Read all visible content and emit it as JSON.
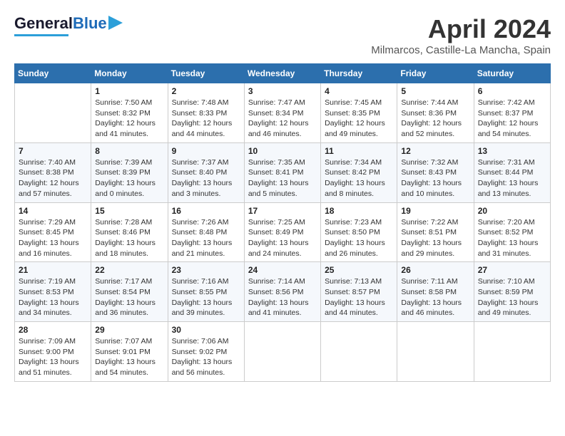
{
  "header": {
    "logo_general": "General",
    "logo_blue": "Blue",
    "month_title": "April 2024",
    "location": "Milmarcos, Castille-La Mancha, Spain"
  },
  "days_of_week": [
    "Sunday",
    "Monday",
    "Tuesday",
    "Wednesday",
    "Thursday",
    "Friday",
    "Saturday"
  ],
  "weeks": [
    [
      {
        "day": "",
        "sunrise": "",
        "sunset": "",
        "daylight": ""
      },
      {
        "day": "1",
        "sunrise": "Sunrise: 7:50 AM",
        "sunset": "Sunset: 8:32 PM",
        "daylight": "Daylight: 12 hours and 41 minutes."
      },
      {
        "day": "2",
        "sunrise": "Sunrise: 7:48 AM",
        "sunset": "Sunset: 8:33 PM",
        "daylight": "Daylight: 12 hours and 44 minutes."
      },
      {
        "day": "3",
        "sunrise": "Sunrise: 7:47 AM",
        "sunset": "Sunset: 8:34 PM",
        "daylight": "Daylight: 12 hours and 46 minutes."
      },
      {
        "day": "4",
        "sunrise": "Sunrise: 7:45 AM",
        "sunset": "Sunset: 8:35 PM",
        "daylight": "Daylight: 12 hours and 49 minutes."
      },
      {
        "day": "5",
        "sunrise": "Sunrise: 7:44 AM",
        "sunset": "Sunset: 8:36 PM",
        "daylight": "Daylight: 12 hours and 52 minutes."
      },
      {
        "day": "6",
        "sunrise": "Sunrise: 7:42 AM",
        "sunset": "Sunset: 8:37 PM",
        "daylight": "Daylight: 12 hours and 54 minutes."
      }
    ],
    [
      {
        "day": "7",
        "sunrise": "Sunrise: 7:40 AM",
        "sunset": "Sunset: 8:38 PM",
        "daylight": "Daylight: 12 hours and 57 minutes."
      },
      {
        "day": "8",
        "sunrise": "Sunrise: 7:39 AM",
        "sunset": "Sunset: 8:39 PM",
        "daylight": "Daylight: 13 hours and 0 minutes."
      },
      {
        "day": "9",
        "sunrise": "Sunrise: 7:37 AM",
        "sunset": "Sunset: 8:40 PM",
        "daylight": "Daylight: 13 hours and 3 minutes."
      },
      {
        "day": "10",
        "sunrise": "Sunrise: 7:35 AM",
        "sunset": "Sunset: 8:41 PM",
        "daylight": "Daylight: 13 hours and 5 minutes."
      },
      {
        "day": "11",
        "sunrise": "Sunrise: 7:34 AM",
        "sunset": "Sunset: 8:42 PM",
        "daylight": "Daylight: 13 hours and 8 minutes."
      },
      {
        "day": "12",
        "sunrise": "Sunrise: 7:32 AM",
        "sunset": "Sunset: 8:43 PM",
        "daylight": "Daylight: 13 hours and 10 minutes."
      },
      {
        "day": "13",
        "sunrise": "Sunrise: 7:31 AM",
        "sunset": "Sunset: 8:44 PM",
        "daylight": "Daylight: 13 hours and 13 minutes."
      }
    ],
    [
      {
        "day": "14",
        "sunrise": "Sunrise: 7:29 AM",
        "sunset": "Sunset: 8:45 PM",
        "daylight": "Daylight: 13 hours and 16 minutes."
      },
      {
        "day": "15",
        "sunrise": "Sunrise: 7:28 AM",
        "sunset": "Sunset: 8:46 PM",
        "daylight": "Daylight: 13 hours and 18 minutes."
      },
      {
        "day": "16",
        "sunrise": "Sunrise: 7:26 AM",
        "sunset": "Sunset: 8:48 PM",
        "daylight": "Daylight: 13 hours and 21 minutes."
      },
      {
        "day": "17",
        "sunrise": "Sunrise: 7:25 AM",
        "sunset": "Sunset: 8:49 PM",
        "daylight": "Daylight: 13 hours and 24 minutes."
      },
      {
        "day": "18",
        "sunrise": "Sunrise: 7:23 AM",
        "sunset": "Sunset: 8:50 PM",
        "daylight": "Daylight: 13 hours and 26 minutes."
      },
      {
        "day": "19",
        "sunrise": "Sunrise: 7:22 AM",
        "sunset": "Sunset: 8:51 PM",
        "daylight": "Daylight: 13 hours and 29 minutes."
      },
      {
        "day": "20",
        "sunrise": "Sunrise: 7:20 AM",
        "sunset": "Sunset: 8:52 PM",
        "daylight": "Daylight: 13 hours and 31 minutes."
      }
    ],
    [
      {
        "day": "21",
        "sunrise": "Sunrise: 7:19 AM",
        "sunset": "Sunset: 8:53 PM",
        "daylight": "Daylight: 13 hours and 34 minutes."
      },
      {
        "day": "22",
        "sunrise": "Sunrise: 7:17 AM",
        "sunset": "Sunset: 8:54 PM",
        "daylight": "Daylight: 13 hours and 36 minutes."
      },
      {
        "day": "23",
        "sunrise": "Sunrise: 7:16 AM",
        "sunset": "Sunset: 8:55 PM",
        "daylight": "Daylight: 13 hours and 39 minutes."
      },
      {
        "day": "24",
        "sunrise": "Sunrise: 7:14 AM",
        "sunset": "Sunset: 8:56 PM",
        "daylight": "Daylight: 13 hours and 41 minutes."
      },
      {
        "day": "25",
        "sunrise": "Sunrise: 7:13 AM",
        "sunset": "Sunset: 8:57 PM",
        "daylight": "Daylight: 13 hours and 44 minutes."
      },
      {
        "day": "26",
        "sunrise": "Sunrise: 7:11 AM",
        "sunset": "Sunset: 8:58 PM",
        "daylight": "Daylight: 13 hours and 46 minutes."
      },
      {
        "day": "27",
        "sunrise": "Sunrise: 7:10 AM",
        "sunset": "Sunset: 8:59 PM",
        "daylight": "Daylight: 13 hours and 49 minutes."
      }
    ],
    [
      {
        "day": "28",
        "sunrise": "Sunrise: 7:09 AM",
        "sunset": "Sunset: 9:00 PM",
        "daylight": "Daylight: 13 hours and 51 minutes."
      },
      {
        "day": "29",
        "sunrise": "Sunrise: 7:07 AM",
        "sunset": "Sunset: 9:01 PM",
        "daylight": "Daylight: 13 hours and 54 minutes."
      },
      {
        "day": "30",
        "sunrise": "Sunrise: 7:06 AM",
        "sunset": "Sunset: 9:02 PM",
        "daylight": "Daylight: 13 hours and 56 minutes."
      },
      {
        "day": "",
        "sunrise": "",
        "sunset": "",
        "daylight": ""
      },
      {
        "day": "",
        "sunrise": "",
        "sunset": "",
        "daylight": ""
      },
      {
        "day": "",
        "sunrise": "",
        "sunset": "",
        "daylight": ""
      },
      {
        "day": "",
        "sunrise": "",
        "sunset": "",
        "daylight": ""
      }
    ]
  ]
}
